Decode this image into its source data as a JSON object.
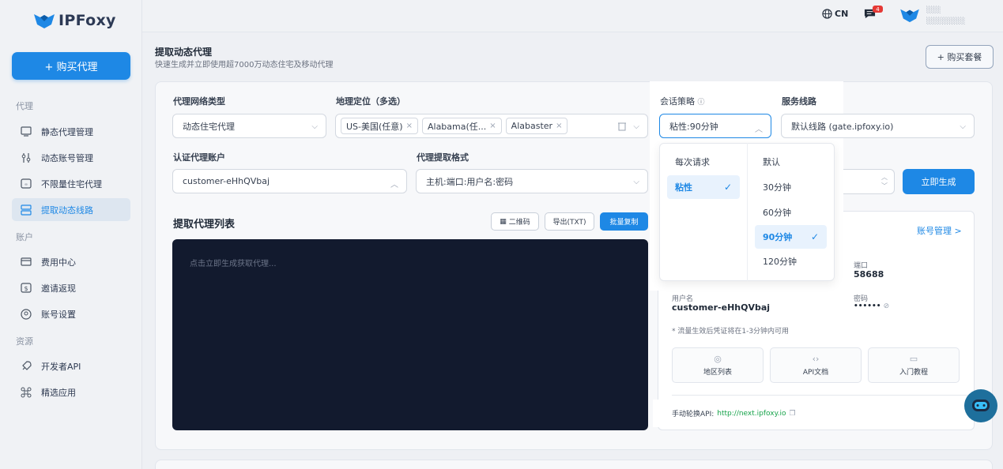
{
  "brand": {
    "name": "IPFoxy"
  },
  "sidebar": {
    "buy_label": "+ 购买代理",
    "sections": {
      "proxy": "代理",
      "account": "账户",
      "resources": "资源"
    },
    "items": [
      {
        "label": "静态代理管理",
        "icon": "monitor-icon"
      },
      {
        "label": "动态账号管理",
        "icon": "sliders-icon"
      },
      {
        "label": "不限量住宅代理",
        "icon": "unlimited-icon"
      },
      {
        "label": "提取动态线路",
        "icon": "server-icon"
      },
      {
        "label": "费用中心",
        "icon": "wallet-icon"
      },
      {
        "label": "邀请返现",
        "icon": "dollar-icon"
      },
      {
        "label": "账号设置",
        "icon": "user-circle-icon"
      },
      {
        "label": "开发者API",
        "icon": "rocket-icon"
      },
      {
        "label": "精选应用",
        "icon": "apps-icon"
      }
    ]
  },
  "topbar": {
    "lang": "CN",
    "notifications": "4"
  },
  "page": {
    "title": "提取动态代理",
    "subtitle": "快速生成并立即使用超7000万动态住宅及移动代理",
    "buy_pkg": "+ 购买套餐"
  },
  "form": {
    "network_type_label": "代理网络类型",
    "network_type_value": "动态住宅代理",
    "geo_label": "地理定位（多选）",
    "geo_tags": [
      "US-美国(任意)",
      "Alabama(任...",
      "Alabaster"
    ],
    "auth_label": "认证代理账户",
    "auth_value": "customer-eHhQVbaj",
    "format_label": "代理提取格式",
    "format_value": "主机:端口:用户名:密码",
    "session_label": "会话策略",
    "session_value": "粘性:90分钟",
    "route_label": "服务线路",
    "route_value": "默认线路 (gate.ipfoxy.io)",
    "generate": "立即生成"
  },
  "list": {
    "title": "提取代理列表",
    "qr": "二维码",
    "export": "导出(TXT)",
    "bulk_copy": "批量复制",
    "placeholder": "点击立即生成获取代理..."
  },
  "info": {
    "account_link": "账号管理 >",
    "port_label": "端口",
    "port_value": "58688",
    "user_label": "用户名",
    "user_value": "customer-eHhQVbaj",
    "pass_label": "密码",
    "pass_value": "••••••",
    "note": "* 流量生效后凭证将在1-3分钟内可用",
    "tiles": [
      "地区列表",
      "API文档",
      "入门教程"
    ],
    "api_label": "手动轮换API:",
    "api_url": "http://next.ipfoxy.io"
  },
  "dropdown": {
    "left": [
      {
        "label": "每次请求",
        "selected": false
      },
      {
        "label": "粘性",
        "selected": true
      }
    ],
    "right": [
      {
        "label": "默认",
        "selected": false
      },
      {
        "label": "30分钟",
        "selected": false
      },
      {
        "label": "60分钟",
        "selected": false
      },
      {
        "label": "90分钟",
        "selected": true
      },
      {
        "label": "120分钟",
        "selected": false
      }
    ]
  },
  "colors": {
    "accent": "#1e88e5",
    "console": "#121a2e",
    "url": "#16a34a"
  }
}
